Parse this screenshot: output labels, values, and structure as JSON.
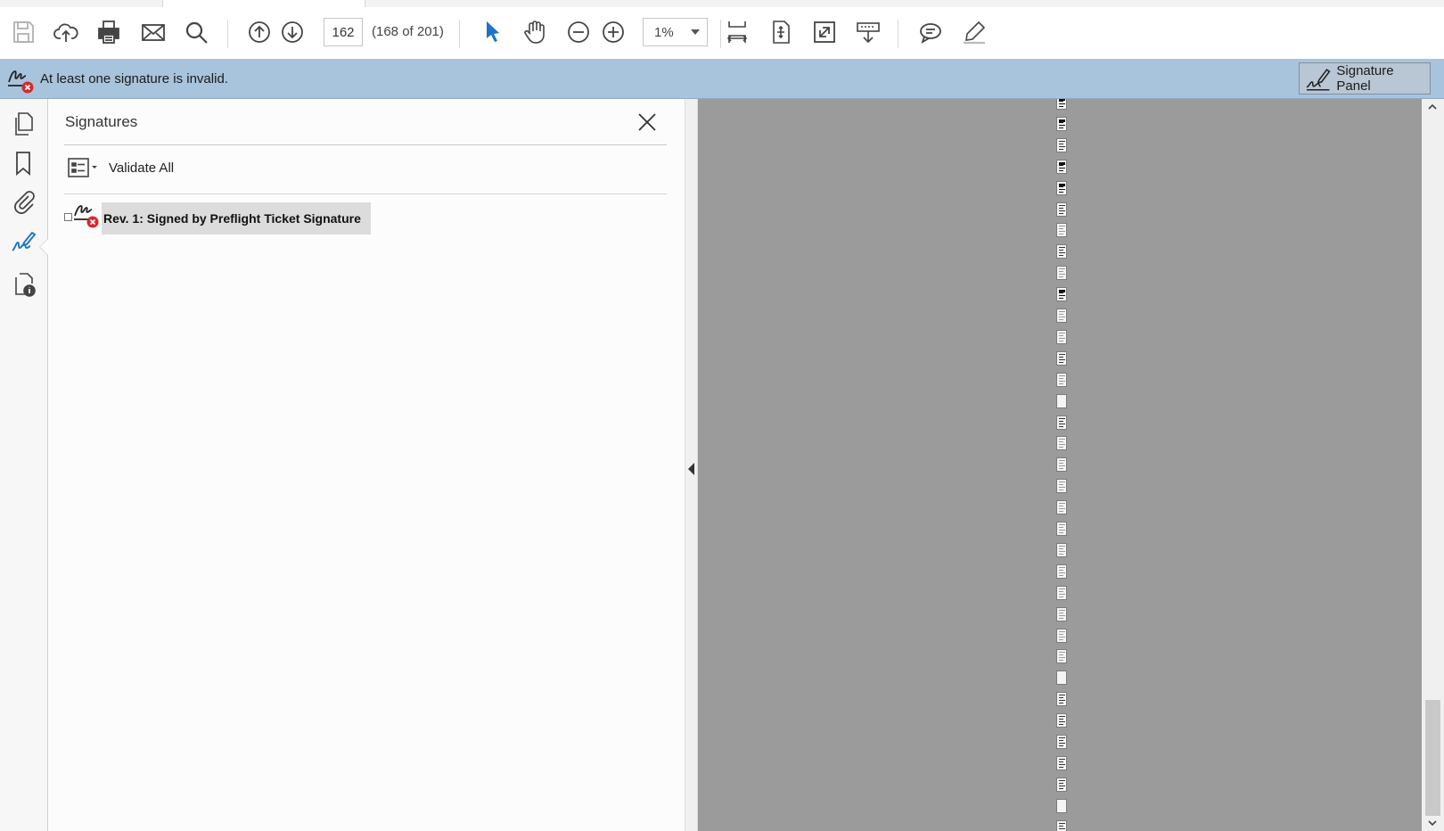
{
  "toolbar": {
    "current_page": "162",
    "page_count_label": "(168 of 201)",
    "zoom_value": "1%",
    "icons": [
      "save-icon",
      "cloud-upload-icon",
      "print-icon",
      "email-icon",
      "search-icon",
      "page-up-icon",
      "page-down-icon",
      "select-cursor-icon",
      "hand-icon",
      "zoom-out-icon",
      "zoom-in-icon",
      "fit-width-icon",
      "fit-page-icon",
      "full-screen-icon",
      "read-aloud-icon",
      "comment-icon",
      "highlight-pen-icon"
    ]
  },
  "infobar": {
    "message": "At least one signature is invalid.",
    "button_label": "Signature Panel"
  },
  "leftrail": {
    "icons": [
      "page-thumbnails-icon",
      "bookmarks-icon",
      "attachments-icon",
      "signatures-icon",
      "document-info-icon"
    ]
  },
  "panel": {
    "title": "Signatures",
    "validate_all_label": "Validate All",
    "signatures": [
      {
        "label": "Rev. 1: Signed by Preflight Ticket Signature",
        "status": "invalid"
      }
    ]
  },
  "colors": {
    "infobar_bg": "#a8c4dc",
    "accent_blue": "#1e73c7",
    "error_red": "#d9262c",
    "doc_bg": "#9b9b9b"
  }
}
